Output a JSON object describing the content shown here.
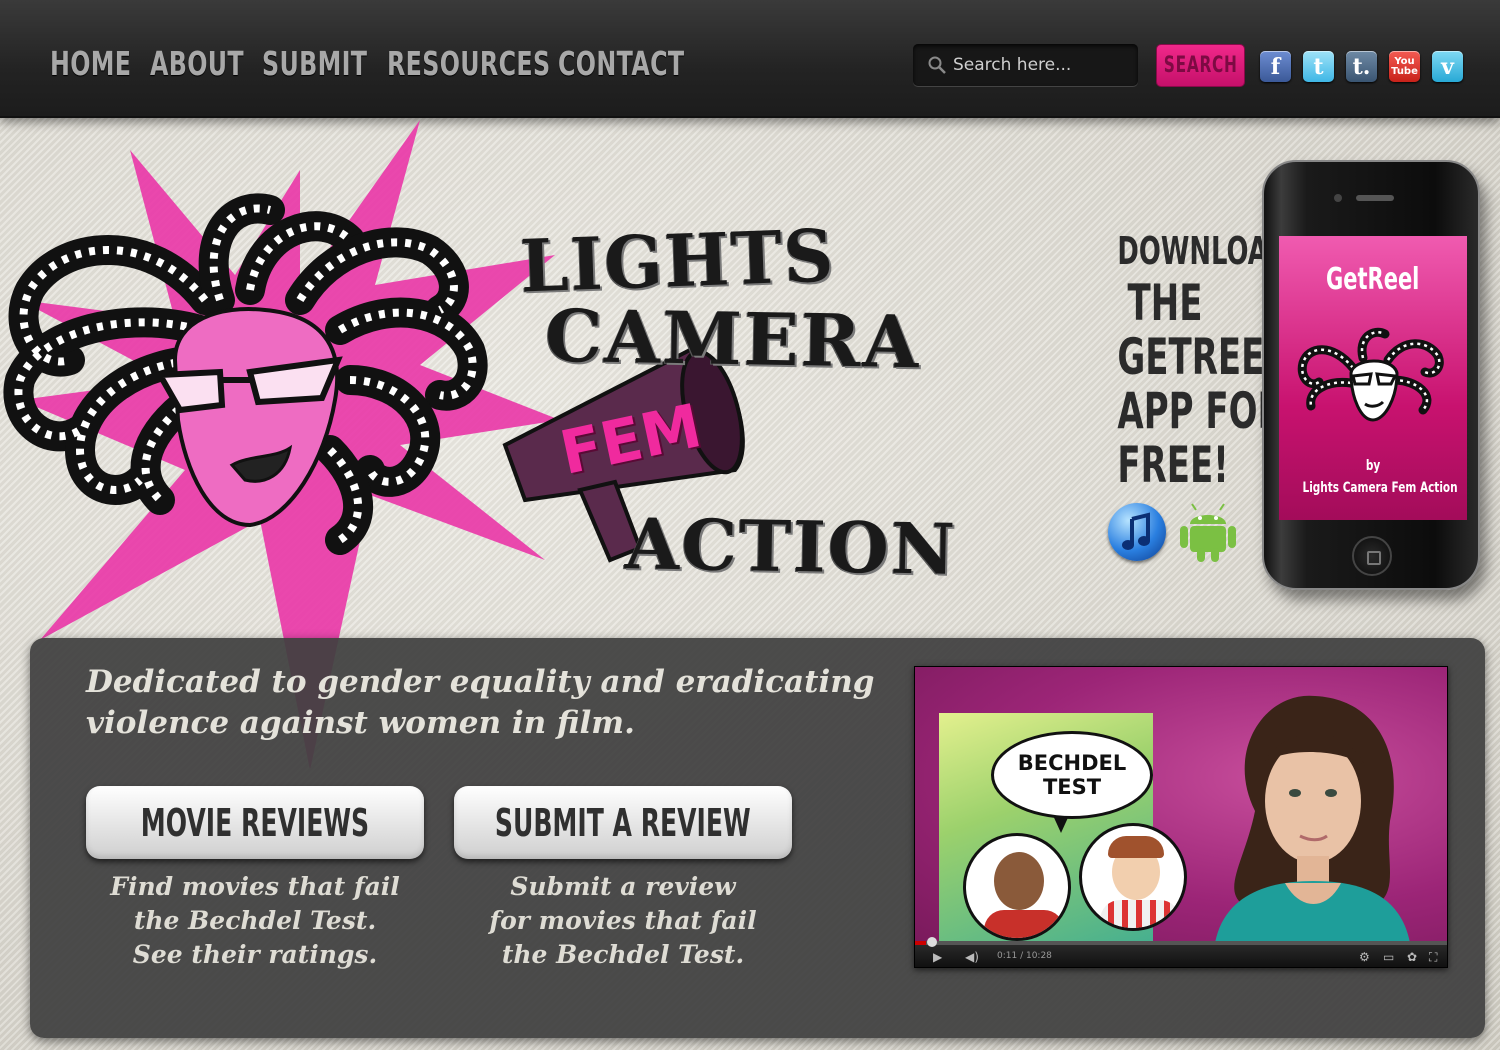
{
  "nav": {
    "links": [
      "HOME",
      "ABOUT",
      "SUBMIT",
      "RESOURCES",
      "CONTACT"
    ],
    "search_placeholder": "Search here...",
    "search_button": "SEARCH",
    "social": [
      {
        "name": "facebook-icon",
        "glyph": "f"
      },
      {
        "name": "twitter-icon",
        "glyph": "t"
      },
      {
        "name": "tumblr-icon",
        "glyph": "t."
      },
      {
        "name": "youtube-icon",
        "glyph": "You Tube"
      },
      {
        "name": "vimeo-icon",
        "glyph": "v"
      }
    ]
  },
  "logo": {
    "line1": "LIGHTS",
    "line2": "CAMERA",
    "line3": "FEM",
    "line4": "ACTION"
  },
  "download": {
    "line1": "DOWNLOAD",
    "line2": "THE",
    "line3": "GETREEL",
    "line4": "APP FOR",
    "line5": "FREE!"
  },
  "phone": {
    "app_name": "GetReel",
    "by": "by",
    "org": "Lights Camera Fem Action"
  },
  "main": {
    "tagline": "Dedicated to gender equality and eradicating violence against women in film.",
    "cta": [
      {
        "label": "MOVIE REVIEWS",
        "desc": [
          "Find movies that fail",
          "the Bechdel Test.",
          "See their ratings."
        ]
      },
      {
        "label": "SUBMIT A REVIEW",
        "desc": [
          "Submit a review",
          "for movies that fail",
          "the Bechdel Test."
        ]
      }
    ]
  },
  "video": {
    "bubble_line1": "BECHDEL",
    "bubble_line2": "TEST",
    "time": "0:11 / 10:28",
    "progress": 0.02
  },
  "colors": {
    "accent": "#e91e8c",
    "panel": "#404040",
    "nav_text": "#a8a8a8"
  }
}
